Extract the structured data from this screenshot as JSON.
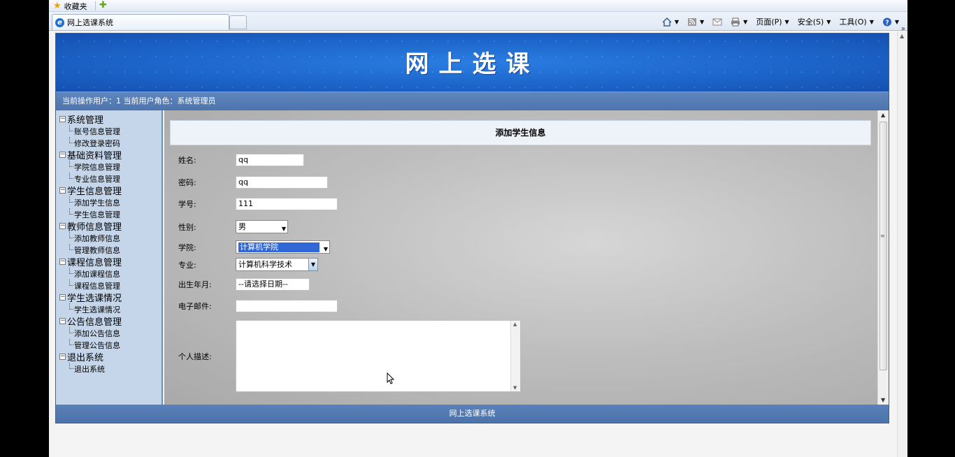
{
  "browser": {
    "favorites_label": "收藏夹",
    "tab_title": "网上选课系统",
    "cmd": {
      "page_label": "页面(P)",
      "safety_label": "安全(S)",
      "tools_label": "工具(O)"
    }
  },
  "app": {
    "banner_title": "网上选课",
    "userbar_text": "当前操作用户：1 当前用户角色：系统管理员",
    "footer_text": "网上选课系统"
  },
  "sidebar": {
    "groups": [
      {
        "label": "系统管理",
        "items": [
          "账号信息管理",
          "修改登录密码"
        ]
      },
      {
        "label": "基础资料管理",
        "items": [
          "学院信息管理",
          "专业信息管理"
        ]
      },
      {
        "label": "学生信息管理",
        "items": [
          "添加学生信息",
          "学生信息管理"
        ]
      },
      {
        "label": "教师信息管理",
        "items": [
          "添加教师信息",
          "管理教师信息"
        ]
      },
      {
        "label": "课程信息管理",
        "items": [
          "添加课程信息",
          "课程信息管理"
        ]
      },
      {
        "label": "学生选课情况",
        "items": [
          "学生选课情况"
        ]
      },
      {
        "label": "公告信息管理",
        "items": [
          "添加公告信息",
          "管理公告信息"
        ]
      },
      {
        "label": "退出系统",
        "items": [
          "退出系统"
        ]
      }
    ]
  },
  "form": {
    "title": "添加学生信息",
    "name": {
      "label": "姓名:",
      "value": "qq"
    },
    "password": {
      "label": "密码:",
      "value": "qq"
    },
    "student_no": {
      "label": "学号:",
      "value": "111"
    },
    "gender": {
      "label": "性别:",
      "value": "男"
    },
    "college": {
      "label": "学院:",
      "value": "计算机学院"
    },
    "major": {
      "label": "专业:",
      "value": "计算机科学技术"
    },
    "birth": {
      "label": "出生年月:",
      "value": "--请选择日期--"
    },
    "email": {
      "label": "电子邮件:",
      "value": ""
    },
    "description": {
      "label": "个人描述:",
      "value": ""
    }
  }
}
